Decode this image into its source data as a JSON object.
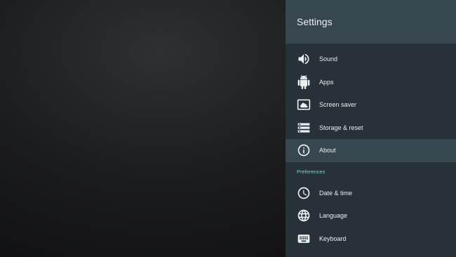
{
  "settings": {
    "title": "Settings",
    "items": [
      {
        "id": "sound",
        "label": "Sound",
        "icon": "volume-icon"
      },
      {
        "id": "apps",
        "label": "Apps",
        "icon": "android-icon"
      },
      {
        "id": "screen-saver",
        "label": "Screen saver",
        "icon": "screen-saver-icon"
      },
      {
        "id": "storage-reset",
        "label": "Storage & reset",
        "icon": "storage-icon"
      },
      {
        "id": "about",
        "label": "About",
        "icon": "info-icon",
        "selected": true
      }
    ],
    "preferences": {
      "header": "Preferences",
      "items": [
        {
          "id": "date-time",
          "label": "Date & time",
          "icon": "clock-icon"
        },
        {
          "id": "language",
          "label": "Language",
          "icon": "globe-icon"
        },
        {
          "id": "keyboard",
          "label": "Keyboard",
          "icon": "keyboard-icon"
        }
      ]
    }
  },
  "colors": {
    "panel_background": "#263238",
    "header_background": "#37474f",
    "selected_background": "#37474f",
    "text": "#eceff1",
    "section_accent": "#80cbc4"
  }
}
